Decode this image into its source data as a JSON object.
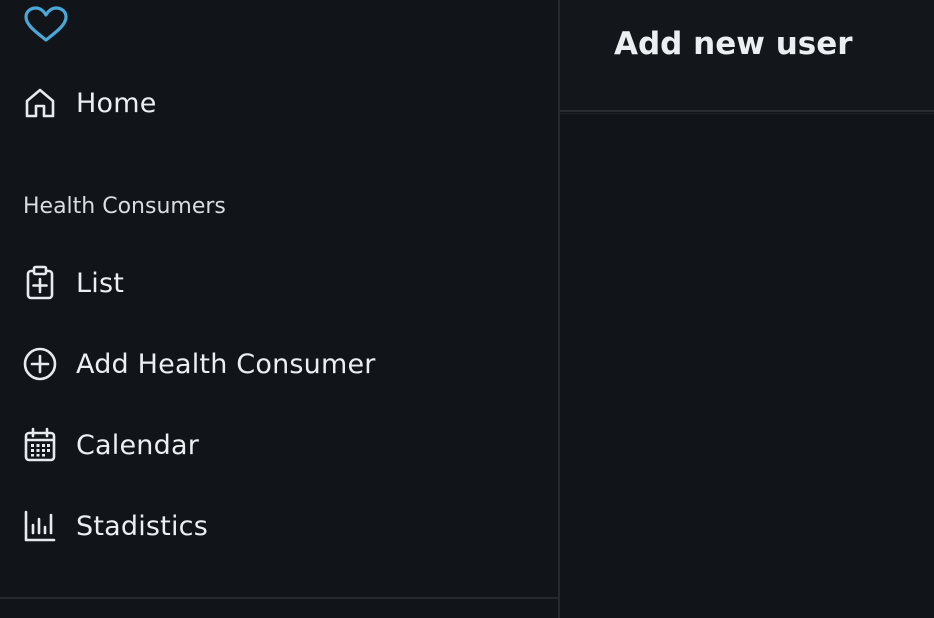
{
  "app": {
    "logo_icon": "heart-icon",
    "accent_color": "#4aa8d8"
  },
  "sidebar": {
    "home": {
      "label": "Home",
      "icon": "home-icon"
    },
    "section_heading": "Health Consumers",
    "items": [
      {
        "label": "List",
        "icon": "clipboard-plus-icon"
      },
      {
        "label": "Add Health Consumer",
        "icon": "plus-circle-icon"
      },
      {
        "label": "Calendar",
        "icon": "calendar-icon"
      },
      {
        "label": "Stadistics",
        "icon": "bar-chart-icon"
      }
    ]
  },
  "main": {
    "title": "Add new user"
  }
}
